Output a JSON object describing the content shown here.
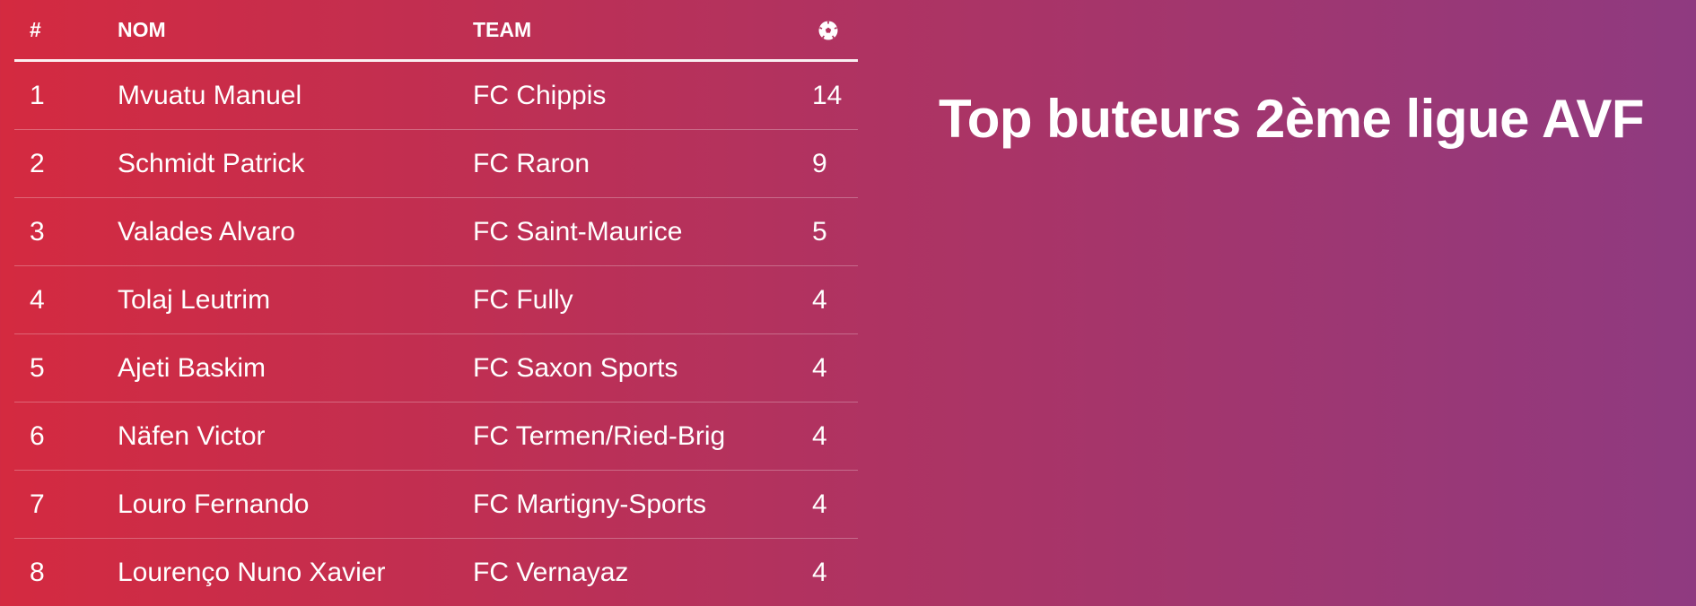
{
  "page": {
    "title": "Top buteurs 2ème ligue AVF",
    "gradient_colors": [
      "#d42a40",
      "#b3325e",
      "#8f3a80"
    ]
  },
  "table": {
    "headers": {
      "rank": "#",
      "name": "NOM",
      "team": "TEAM",
      "goals_icon": "soccer-ball-icon"
    },
    "rows": [
      {
        "rank": "1",
        "name": "Mvuatu Manuel",
        "team": "FC Chippis",
        "goals": "14"
      },
      {
        "rank": "2",
        "name": "Schmidt Patrick",
        "team": "FC Raron",
        "goals": "9"
      },
      {
        "rank": "3",
        "name": "Valades Alvaro",
        "team": "FC Saint-Maurice",
        "goals": "5"
      },
      {
        "rank": "4",
        "name": "Tolaj Leutrim",
        "team": "FC Fully",
        "goals": "4"
      },
      {
        "rank": "5",
        "name": "Ajeti Baskim",
        "team": "FC Saxon Sports",
        "goals": "4"
      },
      {
        "rank": "6",
        "name": "Näfen Victor",
        "team": "FC Termen/Ried-Brig",
        "goals": "4"
      },
      {
        "rank": "7",
        "name": "Louro Fernando",
        "team": "FC Martigny-Sports",
        "goals": "4"
      },
      {
        "rank": "8",
        "name": "Lourenço Nuno Xavier",
        "team": "FC Vernayaz",
        "goals": "4"
      }
    ]
  }
}
